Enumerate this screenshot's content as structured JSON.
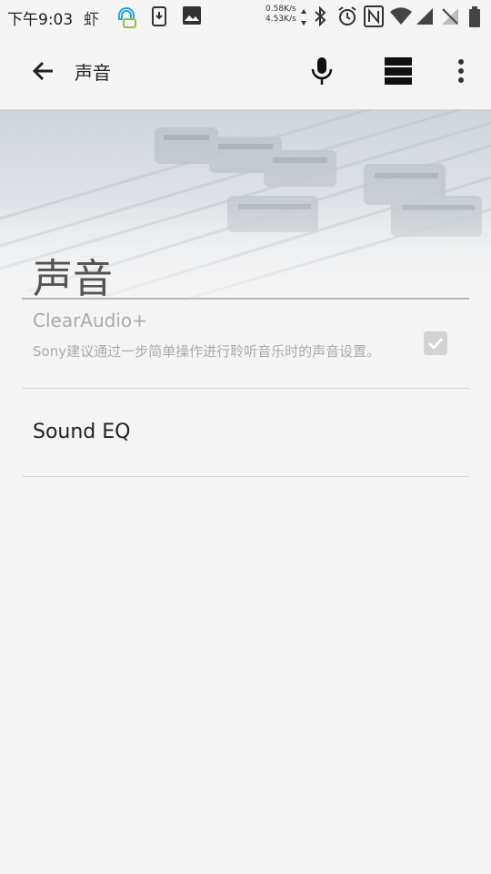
{
  "status_bar": {
    "time": "下午9:03",
    "speed_up": "0.58K/s",
    "speed_down": "4.53K/s"
  },
  "app_bar": {
    "title": "声音",
    "icons": [
      "back-arrow-icon",
      "mic-icon",
      "view-icon",
      "more-vert-icon"
    ]
  },
  "header": {
    "title": "声音"
  },
  "prefs": [
    {
      "title": "ClearAudio+",
      "summary": "Sony建议通过一步简单操作进行聆听音乐时的声音设置。",
      "checked": true,
      "enabled": false
    },
    {
      "title": "Sound EQ"
    }
  ],
  "colors": {
    "background": "#f5f5f5",
    "disabled_text": "#aaaaaa",
    "divider": "#d6d6d6"
  }
}
